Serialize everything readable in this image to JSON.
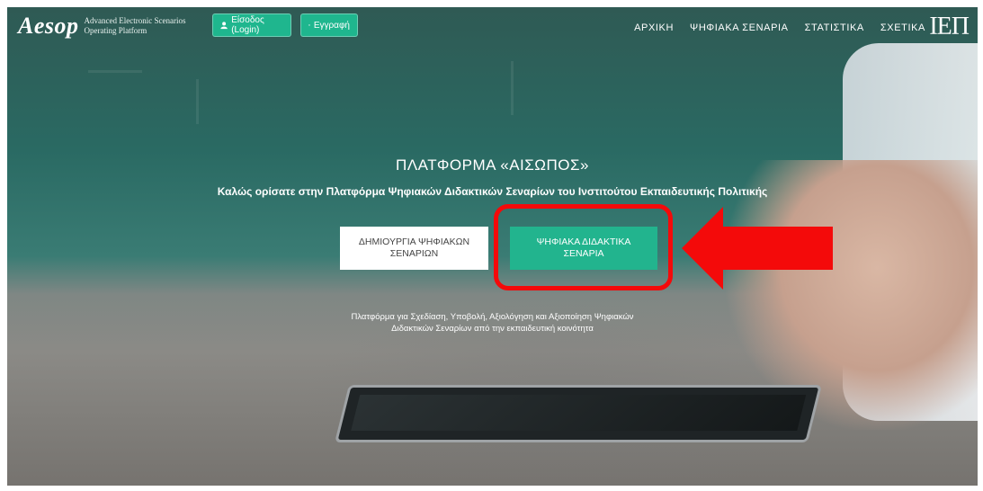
{
  "header": {
    "logo_text": "Aesop",
    "logo_line1": "Advanced Electronic Scenarios",
    "logo_line2": "Operating Platform",
    "login_label": "Είσοδος (Login)",
    "register_label": "Εγγραφή",
    "nav": [
      "ΑΡΧΙΚΗ",
      "ΨΗΦΙΑΚΑ ΣΕΝΑΡΙΑ",
      "ΣΤΑΤΙΣΤΙΚΑ",
      "ΣΧΕΤΙΚΑ"
    ],
    "institute_logo": "ΙΕΠ"
  },
  "hero": {
    "title": "ΠΛΑΤΦΟΡΜΑ «ΑΙΣΩΠΟΣ»",
    "subtitle": "Καλώς ορίσατε στην Πλατφόρμα Ψηφιακών Διδακτικών Σεναρίων του Ινστιτούτου Εκπαιδευτικής Πολιτικής",
    "create_button": "ΔΗΜΙΟΥΡΓΙΑ ΨΗΦΙΑΚΩΝ ΣΕΝΑΡΙΩΝ",
    "scenarios_button": "ΨΗΦΙΑΚΑ ΔΙΔΑΚΤΙΚΑ ΣΕΝΑΡΙΑ",
    "tagline_line1": "Πλατφόρμα για Σχεδίαση, Υποβολή, Αξιολόγηση και Αξιοποίηση Ψηφιακών",
    "tagline_line2": "Διδακτικών Σεναρίων από την εκπαιδευτική κοινότητα"
  },
  "colors": {
    "accent": "#22b48e",
    "annotation": "#f40a0a"
  },
  "icons": {
    "login": "user-icon",
    "register": "register-icon",
    "annotation": "right-pointing-arrow"
  }
}
